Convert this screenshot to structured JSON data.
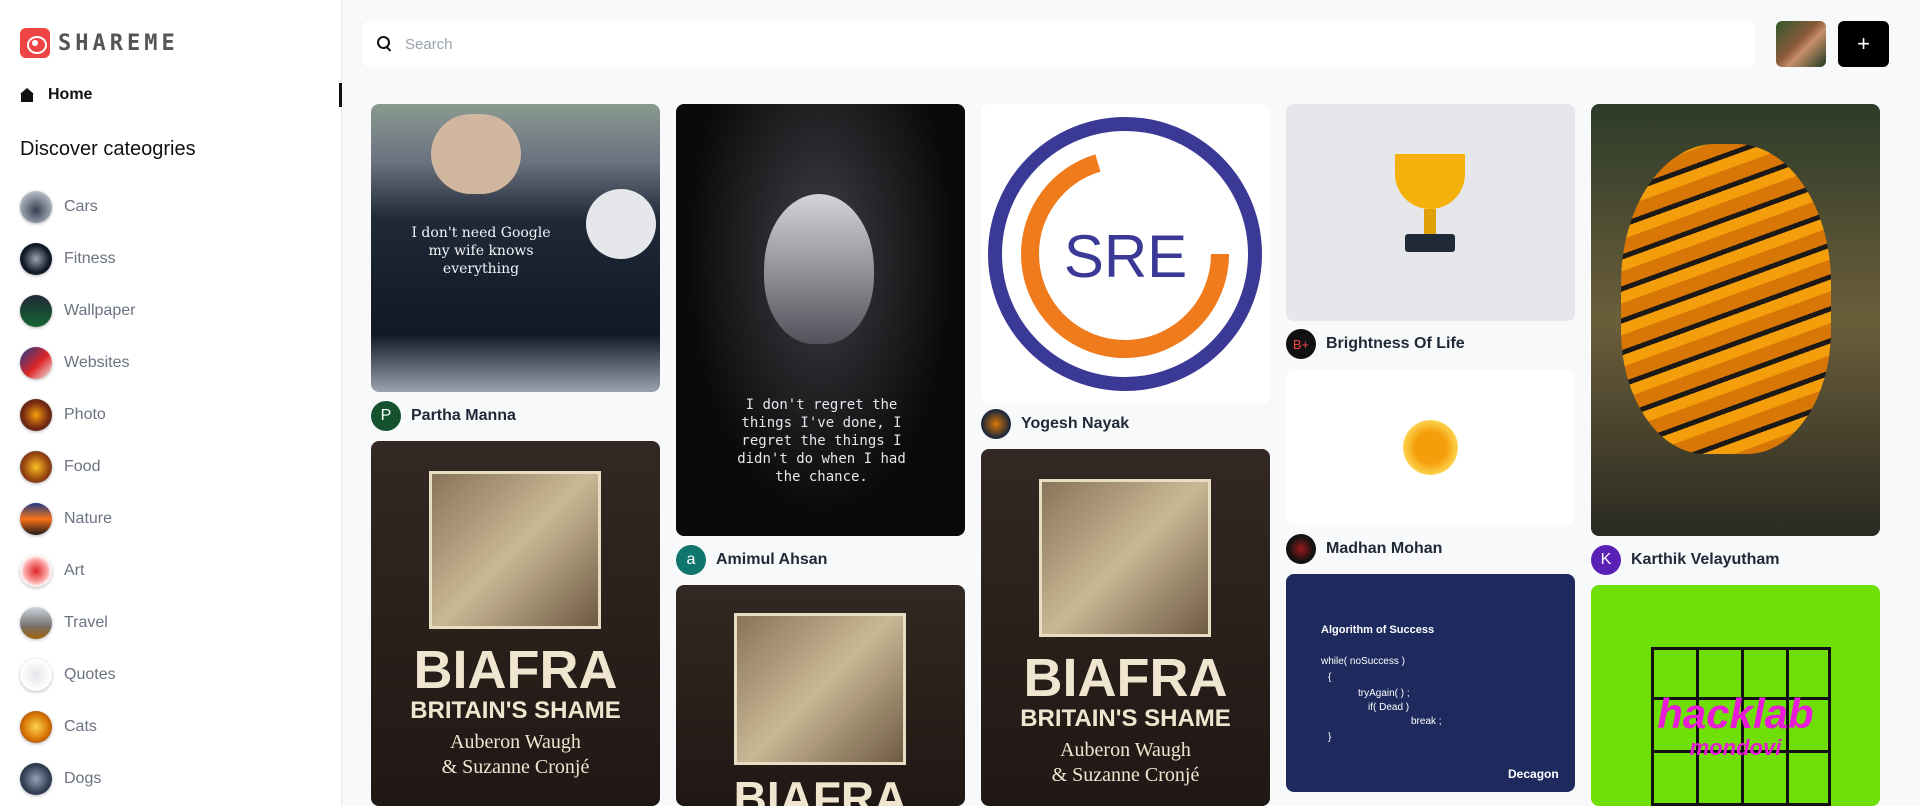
{
  "app": {
    "logo_text": "SHAREME"
  },
  "sidebar": {
    "home_label": "Home",
    "discover_title": "Discover cateogries",
    "categories": [
      {
        "label": "Cars",
        "color": "#6b7280"
      },
      {
        "label": "Fitness",
        "color": "#1f2937"
      },
      {
        "label": "Wallpaper",
        "color": "#14532d"
      },
      {
        "label": "Websites",
        "color": "#1e3a8a"
      },
      {
        "label": "Photo",
        "color": "#7c2d12"
      },
      {
        "label": "Food",
        "color": "#92400e"
      },
      {
        "label": "Nature",
        "color": "#c2410c"
      },
      {
        "label": "Art",
        "color": "#dc2626"
      },
      {
        "label": "Travel",
        "color": "#6b7280"
      },
      {
        "label": "Quotes",
        "color": "#d1d5db"
      },
      {
        "label": "Cats",
        "color": "#d97706"
      },
      {
        "label": "Dogs",
        "color": "#475569"
      }
    ]
  },
  "search": {
    "placeholder": "Search"
  },
  "header": {
    "add_label": "+"
  },
  "pins": {
    "p1": {
      "author": "Partha Manna",
      "initial": "P",
      "shirt_text": "I don't need Google my wife knows everything"
    },
    "p2": {
      "author": "Amimul Ahsan",
      "initial": "a",
      "quote": "I don't regret the things I've done, I regret the things I didn't do when I had the chance."
    },
    "p3": {
      "author": "Yogesh Nayak",
      "logo_text": "SRE"
    },
    "p4": {
      "author": "Brightness Of Life",
      "initial": "B+"
    },
    "p5": {
      "author": "Madhan Mohan"
    },
    "p6": {
      "author": "Karthik Velayutham",
      "initial": "K"
    },
    "book": {
      "title1": "BIAFRA",
      "title2": "BRITAIN'S SHAME",
      "authors1": "Auberon Waugh",
      "authors2": "& Suzanne Cronjé",
      "title_short": "BIAFRA"
    },
    "code": {
      "heading": "Algorithm of Success",
      "line1": "while( noSuccess )",
      "line2": "{",
      "line3": "tryAgain( ) ;",
      "line4": "if( Dead )",
      "line5": "break ;",
      "line6": "}",
      "brand": "Decagon"
    },
    "hack": {
      "line1": "hacklab",
      "line2": "mondovi"
    }
  }
}
